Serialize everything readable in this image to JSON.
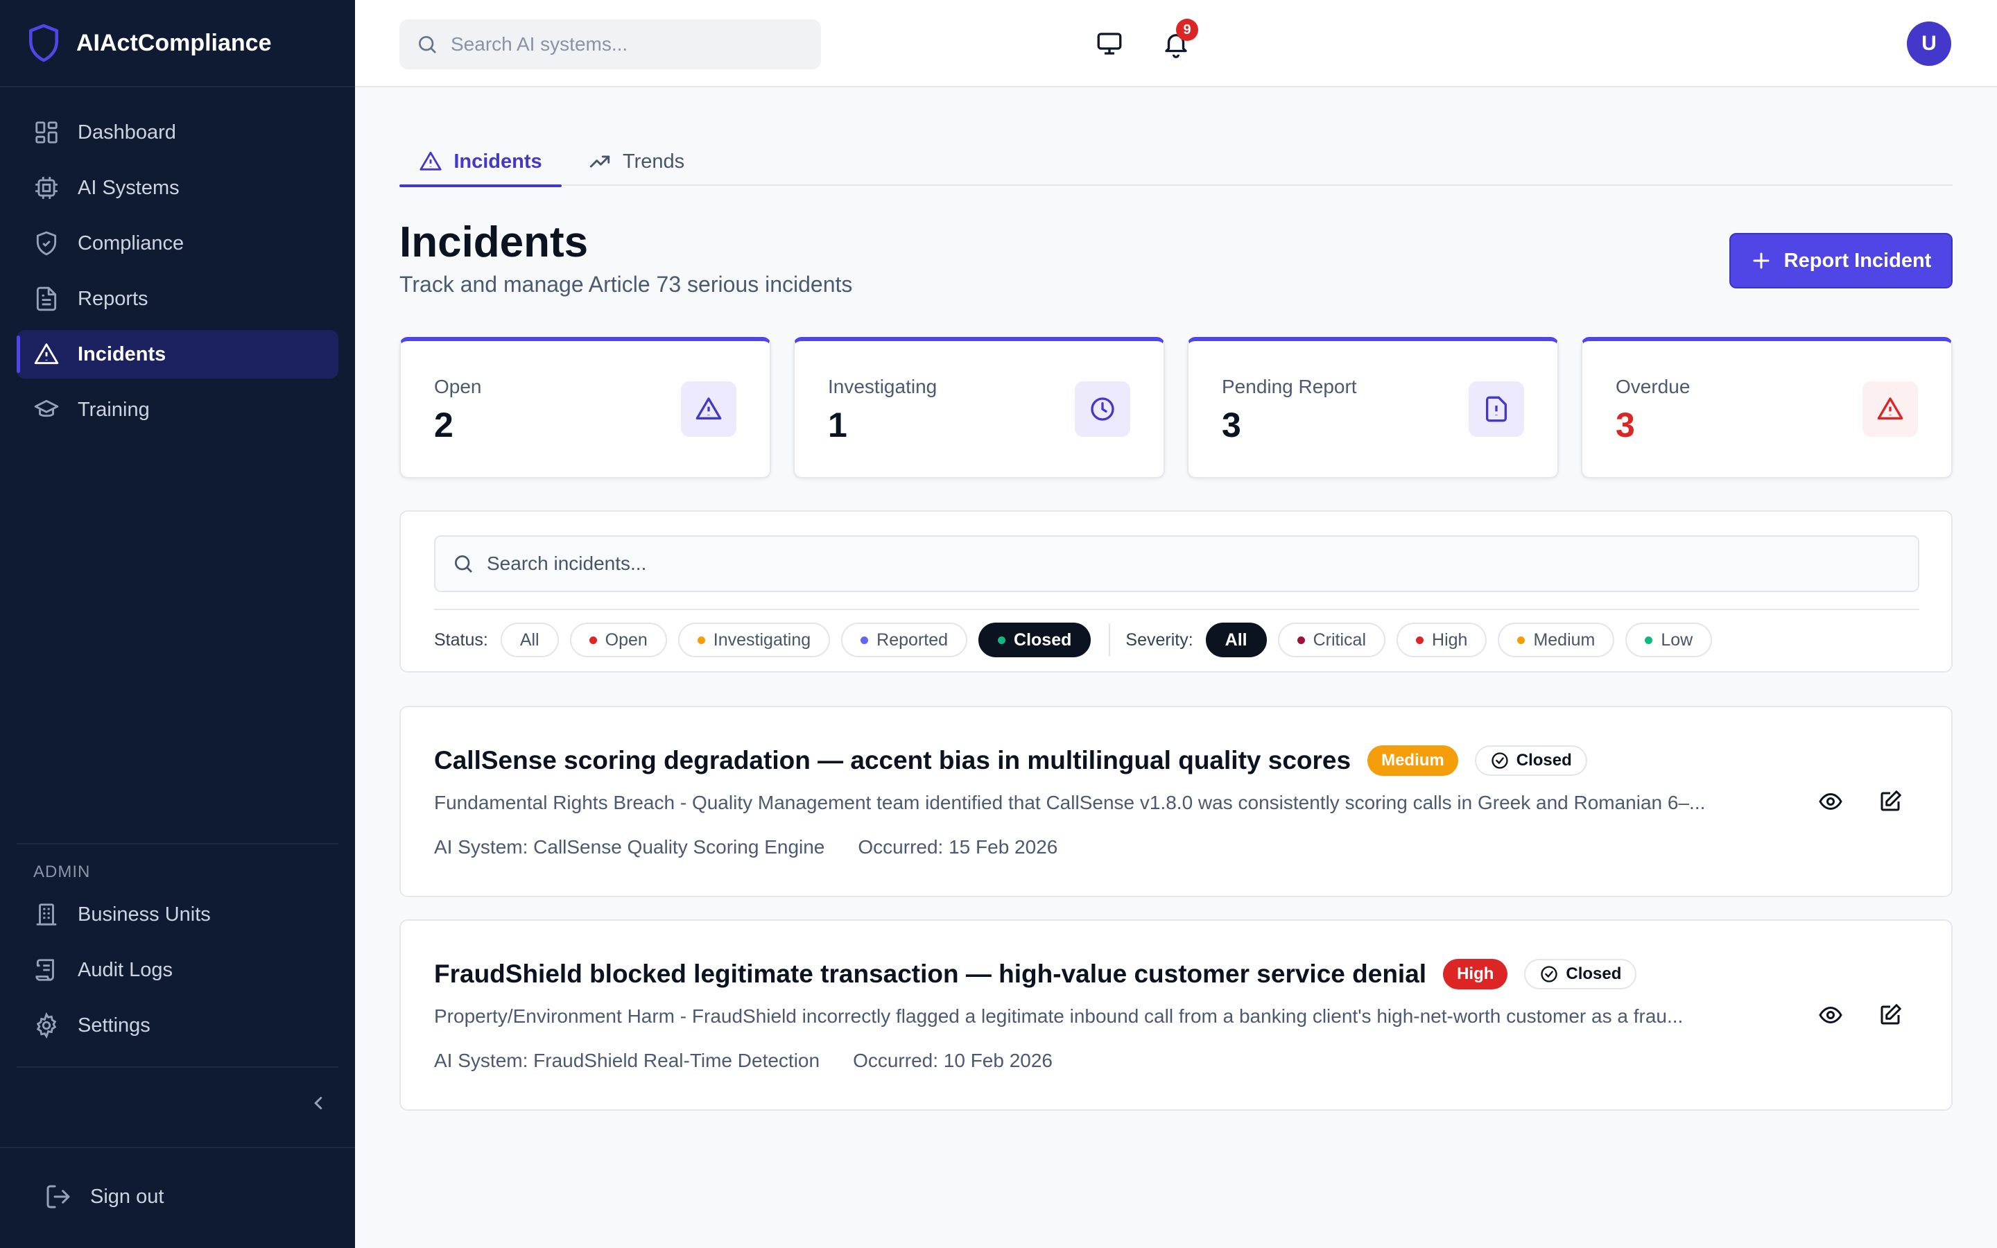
{
  "app": {
    "name": "AIActCompliance"
  },
  "sidebar": {
    "items": [
      {
        "label": "Dashboard",
        "icon": "grid-icon"
      },
      {
        "label": "AI Systems",
        "icon": "cpu-icon"
      },
      {
        "label": "Compliance",
        "icon": "shield-check-icon"
      },
      {
        "label": "Reports",
        "icon": "file-text-icon"
      },
      {
        "label": "Incidents",
        "icon": "alert-triangle-icon",
        "active": true
      },
      {
        "label": "Training",
        "icon": "graduation-cap-icon"
      }
    ],
    "admin_label": "ADMIN",
    "admin_items": [
      {
        "label": "Business Units",
        "icon": "building-icon"
      },
      {
        "label": "Audit Logs",
        "icon": "scroll-icon"
      },
      {
        "label": "Settings",
        "icon": "gear-icon"
      }
    ],
    "sign_out": "Sign out"
  },
  "topbar": {
    "search_placeholder": "Search AI systems...",
    "notification_count": "9",
    "avatar_initial": "U"
  },
  "tabs": [
    {
      "label": "Incidents",
      "icon": "alert-triangle-icon",
      "active": true
    },
    {
      "label": "Trends",
      "icon": "trending-up-icon"
    }
  ],
  "page": {
    "title": "Incidents",
    "subtitle": "Track and manage Article 73 serious incidents",
    "report_button": "Report Incident"
  },
  "stats": [
    {
      "label": "Open",
      "value": "2",
      "icon": "alert-triangle-icon"
    },
    {
      "label": "Investigating",
      "value": "1",
      "icon": "clock-icon"
    },
    {
      "label": "Pending Report",
      "value": "3",
      "icon": "file-alert-icon"
    },
    {
      "label": "Overdue",
      "value": "3",
      "icon": "alert-triangle-icon",
      "alert": true
    }
  ],
  "filters": {
    "search_placeholder": "Search incidents...",
    "status_label": "Status:",
    "status_options": [
      "All",
      "Open",
      "Investigating",
      "Reported",
      "Closed"
    ],
    "status_selected": "Closed",
    "severity_label": "Severity:",
    "severity_options": [
      "All",
      "Critical",
      "High",
      "Medium",
      "Low"
    ],
    "severity_selected": "All"
  },
  "colors": {
    "accent": "#4f46e5",
    "sidebar_bg": "#0f1b33",
    "medium": "#f59e0b",
    "high": "#dc2626",
    "critical": "#9f1239",
    "low": "#10b981",
    "reported": "#6366f1"
  },
  "incidents": [
    {
      "title": "CallSense scoring degradation — accent bias in multilingual quality scores",
      "severity": "Medium",
      "status": "Closed",
      "description": "Fundamental Rights Breach - Quality Management team identified that CallSense v1.8.0 was consistently scoring calls in Greek and Romanian 6–...",
      "ai_system": "AI System: CallSense Quality Scoring Engine",
      "occurred": "Occurred: 15 Feb 2026"
    },
    {
      "title": "FraudShield blocked legitimate transaction — high-value customer service denial",
      "severity": "High",
      "status": "Closed",
      "description": "Property/Environment Harm - FraudShield incorrectly flagged a legitimate inbound call from a banking client's high-net-worth customer as a frau...",
      "ai_system": "AI System: FraudShield Real-Time Detection",
      "occurred": "Occurred: 10 Feb 2026"
    }
  ]
}
